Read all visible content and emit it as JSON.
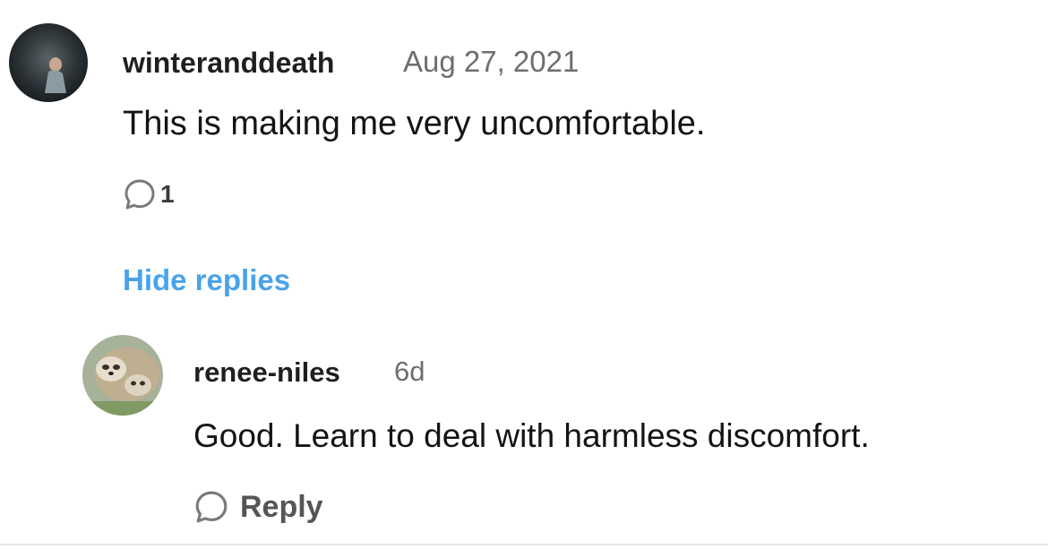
{
  "comment": {
    "username": "winteranddeath",
    "timestamp": "Aug 27, 2021",
    "text": "This is making me very uncomfortable.",
    "reply_count": "1"
  },
  "hide_replies_label": "Hide replies",
  "reply": {
    "username": "renee-niles",
    "timestamp": "6d",
    "text": "Good. Learn to deal with harmless discomfort.",
    "reply_label": "Reply"
  },
  "colors": {
    "link": "#4aa3e8",
    "icon": "#7a7a7a",
    "timestamp": "#6e6e6e"
  },
  "icons": {
    "comment": "speech-bubble-icon",
    "reply": "speech-bubble-icon"
  }
}
